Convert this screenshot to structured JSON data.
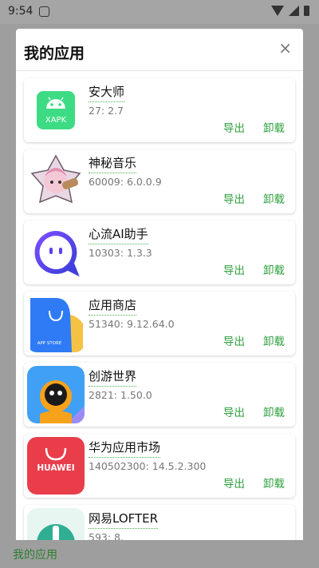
{
  "status_bar": {
    "time": "9:54"
  },
  "dialog": {
    "title": "我的应用",
    "close_icon": "×",
    "export_label": "导出",
    "uninstall_label": "卸载",
    "apps": [
      {
        "name": "安大师",
        "version": "27: 2.7",
        "icon": "android-xapk-icon",
        "icon_text": "XAPK"
      },
      {
        "name": "神秘音乐",
        "version": "60009: 6.0.0.9",
        "icon": "anime-character-icon"
      },
      {
        "name": "心流AI助手",
        "version": "10303: 1.3.3",
        "icon": "chat-bubble-icon"
      },
      {
        "name": "应用商店",
        "version": "51340: 9.12.64.0",
        "icon": "app-store-bag-icon",
        "icon_text": "APP STORE"
      },
      {
        "name": "创游世界",
        "version": "2821: 1.50.0",
        "icon": "game-character-icon"
      },
      {
        "name": "华为应用市场",
        "version": "140502300: 14.5.2.300",
        "icon": "huawei-bag-icon",
        "icon_text": "HUAWEI"
      },
      {
        "name": "网易LOFTER",
        "version": "593: 8.",
        "icon": "lofter-icon"
      }
    ]
  },
  "bottom_bar": {
    "label": "我的应用"
  }
}
